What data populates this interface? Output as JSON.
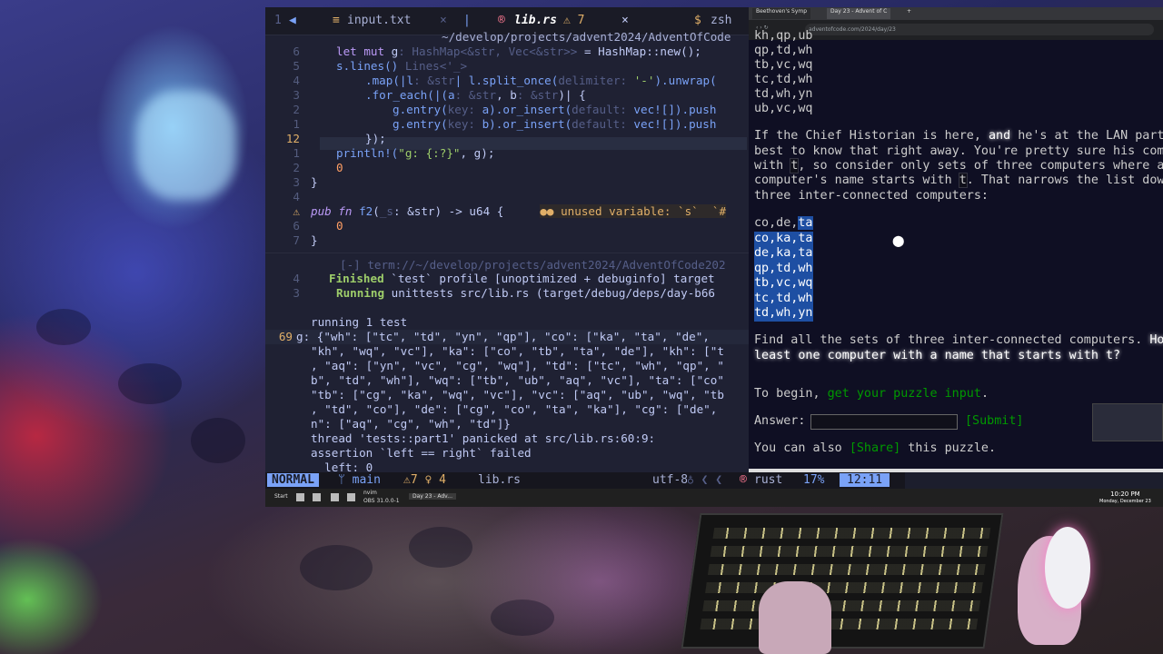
{
  "terminal": {
    "tabs": {
      "left_num": "1",
      "input_tab": "input.txt",
      "lib_tab": "lib.rs",
      "lib_warn": "⚠ 7",
      "zsh_tab": "zsh"
    },
    "path": "~/develop/projects/advent2024/AdventOfCode",
    "code": {
      "l6_num": "6",
      "l6_kw": "let mut",
      "l6_var": " g",
      "l6_hint": ": HashMap<&str, Vec<&str>>",
      "l6_rest": " = HashMap::new();",
      "l5_num": "5",
      "l5_a": "s.lines()",
      "l5_hint": " Lines<'_>",
      "l4_num": "4",
      "l4_a": ".map(|l",
      "l4_hint": ": &str",
      "l4_b": "| l.split_once(",
      "l4_hint2": "delimiter: ",
      "l4_str": "'-'",
      "l4_c": ").unwrap(",
      "l3_num": "3",
      "l3_a": ".for_each(|(a",
      "l3_hint": ": &str",
      "l3_b": ", b",
      "l3_hint2": ": &str",
      "l3_c": ")| {",
      "l2_num": "2",
      "l2_a": "g.entry(",
      "l2_hint": "key: ",
      "l2_b": "a).or_insert(",
      "l2_hint2": "default: ",
      "l2_c": "vec![]).push",
      "l1_num": "1",
      "l1_a": "g.entry(",
      "l1_hint": "key: ",
      "l1_b": "b).or_insert(",
      "l1_hint2": "default: ",
      "l1_c": "vec![]).push",
      "l12_num": "12",
      "l12_a": "});",
      "m1_num": "1",
      "m1_a": "println!(",
      "m1_str": "\"g: {:?}\"",
      "m1_b": ", g);",
      "m2_num": "2",
      "m2_a": "0",
      "m3_num": "3",
      "m3_a": "}",
      "m4_num": "4",
      "m5_num": "5",
      "m5_kw": "pub fn",
      "m5_fn": " f2",
      "m5_a": "(",
      "m5_hint": "_s",
      "m5_b": ": &str) -> u64 {",
      "m5_diag": "●● unused variable: `s`  `#",
      "m6_num": "6",
      "m6_a": "0",
      "m7_num": "7",
      "m7_a": "}"
    },
    "output": {
      "term_header": "[-] term://~/develop/projects/advent2024/AdventOfCode202",
      "o4_num": "4",
      "o4_kw": "Finished",
      "o4_rest": " `test` profile [unoptimized + debuginfo] target",
      "o3_num": "3",
      "o3_kw": "Running",
      "o3_rest": " unittests src/lib.rs (target/debug/deps/day-b66",
      "o1_text": "running 1 test",
      "o69_num": "69",
      "o69_text": "g: {\"wh\": [\"tc\", \"td\", \"yn\", \"qp\"], \"co\": [\"ka\", \"ta\", \"de\",",
      "o_r2": "\"kh\", \"wq\", \"vc\"], \"ka\": [\"co\", \"tb\", \"ta\", \"de\"], \"kh\": [\"t",
      "o_r3": ", \"aq\": [\"yn\", \"vc\", \"cg\", \"wq\"], \"td\": [\"tc\", \"wh\", \"qp\", \"",
      "o_r4": "b\", \"td\", \"wh\"], \"wq\": [\"tb\", \"ub\", \"aq\", \"vc\"], \"ta\": [\"co\"",
      "o_r5": "\"tb\": [\"cg\", \"ka\", \"wq\", \"vc\"], \"vc\": [\"aq\", \"ub\", \"wq\", \"tb",
      "o_r6": ", \"td\", \"co\"], \"de\": [\"cg\", \"co\", \"ta\", \"ka\"], \"cg\": [\"de\",",
      "o_r7": "n\": [\"aq\", \"cg\", \"wh\", \"td\"]}",
      "o_r8": "thread 'tests::part1' panicked at src/lib.rs:60:9:",
      "o_r9": "assertion `left == right` failed",
      "o_r10": "  left: 0"
    },
    "status": {
      "mode": "NORMAL",
      "branch": "ᛘ main",
      "diag": "⚠7 ♀ 4",
      "file": "lib.rs",
      "encoding": "utf-8",
      "ft_icons": "♁ ❮ ❮",
      "lang": "rust",
      "percent": "17%",
      "pos": "12:11"
    }
  },
  "browser": {
    "tab1": "Beethoven's Symp",
    "tab2": "Day 23 - Advent of C",
    "url": "adventofcode.com/2024/day/23",
    "top_lines": [
      "kh,qp,ub",
      "qp,td,wh",
      "tb,vc,wq",
      "tc,td,wh",
      "td,wh,yn",
      "ub,vc,wq"
    ],
    "para1_a": "If the Chief Historian is here, ",
    "para1_em": "and",
    "para1_b": " he's at the LAN party",
    "para1_l2": "best to know that right away. You're pretty sure his comp",
    "para1_l3a": "with ",
    "para1_l3code": "t",
    "para1_l3b": ", so consider only sets of three computers where at",
    "para1_l4a": "computer's name starts with ",
    "para1_l4code": "t",
    "para1_l4b": ". That narrows the list down",
    "para1_l5": "three inter-connected computers:",
    "sel_first_a": "co,de,",
    "sel_first_b": "ta",
    "sel_lines": [
      "co,ka,ta",
      "de,ka,ta",
      "qp,td,wh",
      "tb,vc,wq",
      "tc,td,wh",
      "td,wh,yn"
    ],
    "para2_l1a": "Find all the sets of three inter-connected computers. ",
    "para2_l1em": "How",
    "para2_l2em": "least one computer with a name that starts with t?",
    "begin_a": "To begin, ",
    "begin_link": "get your puzzle input",
    "begin_b": ".",
    "answer_label": "Answer:",
    "submit": "[Submit]",
    "share_a": "You can also ",
    "share_link": "[Share]",
    "share_b": " this puzzle."
  },
  "taskbar": {
    "start": "Start",
    "app1": "nvim",
    "app2": "OBS 31.0.0-1",
    "app3": "Day 23 - Adv...",
    "time": "10:20 PM",
    "date": "Monday, December 23"
  }
}
